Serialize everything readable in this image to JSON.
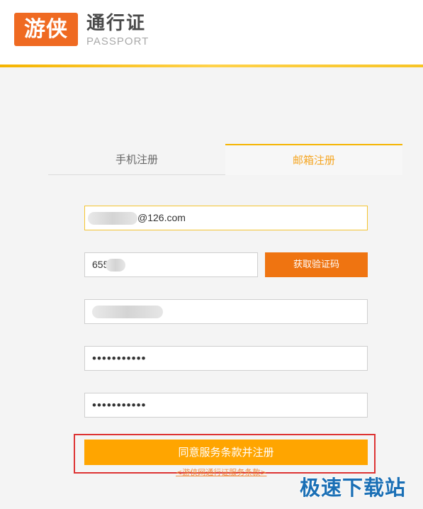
{
  "brand": {
    "logo_text": "游侠",
    "title": "通行证",
    "subtitle": "PASSPORT",
    "accent_color": "#ef6a22"
  },
  "tabs": [
    {
      "label": "手机注册",
      "active": false
    },
    {
      "label": "邮箱注册",
      "active": true
    }
  ],
  "form": {
    "email_value": "@126.com",
    "code_value": "655",
    "get_code_label": "获取验证码",
    "password_mask": "•••••••••••",
    "confirm_password_mask": "•••••••••••",
    "submit_label": "同意服务条款并注册",
    "terms_link": "<游侠网通行证服务条款>"
  },
  "watermark": "极速下载站"
}
